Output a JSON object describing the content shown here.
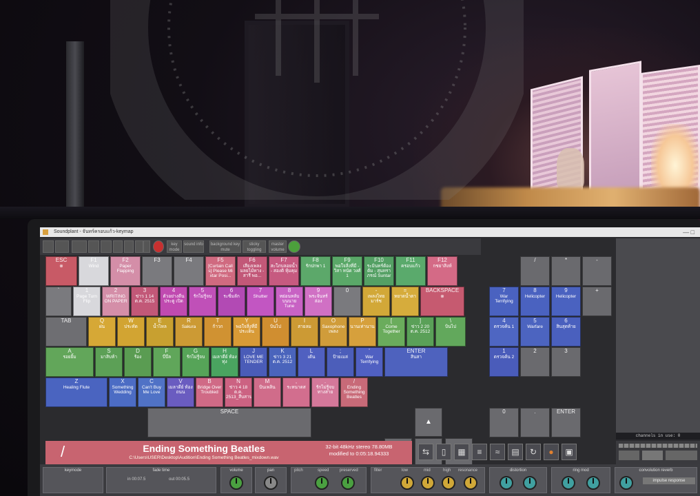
{
  "window": {
    "title": "Soundplant - จันทร์ครอบแก้ว-keymap",
    "close": "—  □"
  },
  "toolbar": {
    "key_mode": "key mode",
    "sound_info": "sound info",
    "background": "background key mute",
    "sticky": "sticky toggling",
    "master": "master volume"
  },
  "keys": [
    {
      "k": "ESC",
      "l": "⊗",
      "c": "#c85a66"
    },
    {
      "k": "F1",
      "l": "Wind",
      "c": "#d8d8dc"
    },
    {
      "k": "F2",
      "l": "Paper Flapping",
      "c": "#d48ea8"
    },
    {
      "k": "F3",
      "l": "",
      "c": "#7a7a7e"
    },
    {
      "k": "F4",
      "l": "",
      "c": "#7a7a7e"
    },
    {
      "k": "F5",
      "l": "[Curtain Call s] Please Mi xtar Posi...",
      "c": "#d06a80"
    },
    {
      "k": "F6",
      "l": "เสียงเพลง มลยไม้ทาง - สารี พอ...",
      "c": "#c25878"
    },
    {
      "k": "F7",
      "l": "สะใภบลอยน้ำ - สองติ หุ้มคุม",
      "c": "#c65a80"
    },
    {
      "k": "F8",
      "l": "รักปกพา 1",
      "c": "#5ca86a"
    },
    {
      "k": "F9",
      "l": "พอใจสิ่งที่มี - วิสา หนัด วงศ์ 1",
      "c": "#5aa868"
    },
    {
      "k": "F10",
      "l": "ระมินทร์ต้อง ต้ม - สุนทรา ภรณ์ Suntar",
      "c": "#54a064"
    },
    {
      "k": "F11",
      "l": "ครอบแก้ว",
      "c": "#5aaa6c"
    },
    {
      "k": "F12",
      "l": "กชยาสิงห์",
      "c": "#d46a86"
    },
    {
      "k": "`",
      "l": "",
      "c": "#7a7a7e"
    },
    {
      "k": "1",
      "l": "Page Turn Flip",
      "c": "#d8d8dc"
    },
    {
      "k": "2",
      "l": "WRITING ON PAPER",
      "c": "#d48ea8"
    },
    {
      "k": "3",
      "l": "ข่าว 1 14 ต.ค. 2515",
      "c": "#c25878"
    },
    {
      "k": "4",
      "l": "ตัวอย่างตีนประตู เปิด",
      "c": "#c04ab0"
    },
    {
      "k": "5",
      "l": "รักไม่รู้จบ",
      "c": "#c050b8"
    },
    {
      "k": "6",
      "l": "ระซิ่มลัก",
      "c": "#b24ab4"
    },
    {
      "k": "7",
      "l": "Shutter",
      "c": "#c256c2"
    },
    {
      "k": "8",
      "l": "หย่อนหลับบนนาย Tune",
      "c": "#c862c4"
    },
    {
      "k": "9",
      "l": "พระจันทร์ล่อง",
      "c": "#d070c4"
    },
    {
      "k": "0",
      "l": "",
      "c": "#7a7a7e"
    },
    {
      "k": "-",
      "l": "เพลงไทยมาร์ช",
      "c": "#d2a838"
    },
    {
      "k": "=",
      "l": "หยาดน้ำตา",
      "c": "#d6ac3c"
    },
    {
      "k": "BACKSPACE",
      "l": "⊗",
      "c": "#c65a70"
    },
    {
      "k": "TAB",
      "l": "",
      "c": "#6e6e72"
    },
    {
      "k": "Q",
      "l": "ฝน",
      "c": "#d6a836"
    },
    {
      "k": "W",
      "l": "ประทัด",
      "c": "#d2a432"
    },
    {
      "k": "E",
      "l": "น้ำไหล",
      "c": "#c8a030"
    },
    {
      "k": "R",
      "l": "Sakura",
      "c": "#cc9a34"
    },
    {
      "k": "T",
      "l": "ก้าวก",
      "c": "#d09232"
    },
    {
      "k": "Y",
      "l": "พอใจสิ่งที่มีประเด็น",
      "c": "#d89a36"
    },
    {
      "k": "U",
      "l": "บินไป",
      "c": "#d08e30"
    },
    {
      "k": "I",
      "l": "สายลม",
      "c": "#cc9a34"
    },
    {
      "k": "O",
      "l": "Saxophone เพลง",
      "c": "#d09c3a"
    },
    {
      "k": "P",
      "l": "นานเท่านาน",
      "c": "#d6a03c"
    },
    {
      "k": "[",
      "l": "Come Together",
      "c": "#6aac5c"
    },
    {
      "k": "]",
      "l": "ข่าว 2 20 ต.ค. 2512",
      "c": "#5aa058"
    },
    {
      "k": "\\",
      "l": "บินไป",
      "c": "#62a85c"
    },
    {
      "k": "A",
      "l": "รอยยิ้ม",
      "c": "#62a65a"
    },
    {
      "k": "S",
      "l": "มาสิบห้า",
      "c": "#5ca056"
    },
    {
      "k": "D",
      "l": "ร้อง",
      "c": "#5a9c52"
    },
    {
      "k": "F",
      "l": "บีบีล",
      "c": "#60a65a"
    },
    {
      "k": "G",
      "l": "รักไม่รู้จบ",
      "c": "#56a458"
    },
    {
      "k": "H",
      "l": "เมลาดีย์ ท้องทุ่ง",
      "c": "#4aa460"
    },
    {
      "k": "J",
      "l": "LOVE ME TENDER",
      "c": "#4a5cb8"
    },
    {
      "k": "K",
      "l": "ข่าว 3 21 ต.ค. 2512",
      "c": "#4a64bc"
    },
    {
      "k": "L",
      "l": "เต้น",
      "c": "#5060c0"
    },
    {
      "k": ";",
      "l": "ป้ายเมล่",
      "c": "#4c5eba"
    },
    {
      "k": "'",
      "l": "War Terrifying",
      "c": "#5060c2"
    },
    {
      "k": "ENTER",
      "l": "สินสา",
      "c": "#4e62be"
    },
    {
      "k": "Z",
      "l": "Healing Flute",
      "c": "#4a64c0"
    },
    {
      "k": "X",
      "l": "Something Wedding",
      "c": "#4c6cc4"
    },
    {
      "k": "C",
      "l": "Can't Buy Me Love",
      "c": "#5072c6"
    },
    {
      "k": "V",
      "l": "เมลาดีย์ ท้องถนน",
      "c": "#6a5cc0"
    },
    {
      "k": "B",
      "l": "Bridge Over Troubled",
      "c": "#d06a86"
    },
    {
      "k": "N",
      "l": "ข่าว 4 18 ต.ค. 2513_สืบสาน",
      "c": "#cc6282"
    },
    {
      "k": "M",
      "l": "บินเพลิน",
      "c": "#d06c8a"
    },
    {
      "k": ",",
      "l": "ระหนาดส",
      "c": "#d26e8e"
    },
    {
      "k": ".",
      "l": "รักไม่รู้จบ ทางสาย",
      "c": "#d4789a"
    },
    {
      "k": "/",
      "l": "Ending Something Beatles",
      "c": "#c86a78"
    },
    {
      "k": "SPACE",
      "l": "",
      "c": "#6a6a6e"
    }
  ],
  "numpad": [
    {
      "k": "/",
      "l": ""
    },
    {
      "k": "*",
      "l": ""
    },
    {
      "k": "-",
      "l": ""
    },
    {
      "k": "7",
      "l": "War Terrifying",
      "c": "#4a62c0"
    },
    {
      "k": "8",
      "l": "Helicopter",
      "c": "#4a62c0"
    },
    {
      "k": "9",
      "l": "Helicopter",
      "c": "#4a62c0"
    },
    {
      "k": "4",
      "l": "ตรวจค้น 1",
      "c": "#4e66c2"
    },
    {
      "k": "5",
      "l": "Warfare",
      "c": "#4c64c0"
    },
    {
      "k": "6",
      "l": "สินสุดท้าย",
      "c": "#4a60be"
    },
    {
      "k": "+",
      "l": ""
    },
    {
      "k": "1",
      "l": "ตรวจค้น 2",
      "c": "#4a5cba"
    },
    {
      "k": "2",
      "l": ""
    },
    {
      "k": "3",
      "l": ""
    },
    {
      "k": "0",
      "l": ""
    },
    {
      "k": ".",
      "l": ""
    },
    {
      "k": "ENTER",
      "l": ""
    }
  ],
  "arrows": {
    "up": "▲",
    "left": "◀",
    "down": "▼",
    "right": "▶"
  },
  "now_playing": {
    "key": "/",
    "title": "Ending Something Beatles",
    "path": "C:\\Users\\USER\\Desktop\\Audition\\Ending Something Beatles_mixdown.wav",
    "format": "32-bit 48kHz stereo 78.80MB",
    "modified": "modified to 0:05:18.94333"
  },
  "channels_label": "channels in use: 0",
  "bottom": {
    "keymode": "keymode",
    "fade_time": "fade time",
    "fade_in": "in 00:07.5",
    "fade_out": "out 00:05.5",
    "volume": "volume",
    "pan": "pan",
    "pitch": "pitch",
    "speed": "speed",
    "preserved": "preserved",
    "filter": "filter",
    "low": "low",
    "mid": "mid",
    "high": "high",
    "resonance": "resonance",
    "distortion": "distortion",
    "ring_mod": "ring mod",
    "convolution": "convolution reverb",
    "impulse": "impulse response"
  },
  "colors": {
    "accent": "#c86470",
    "watermark": "#8a8a8a"
  }
}
